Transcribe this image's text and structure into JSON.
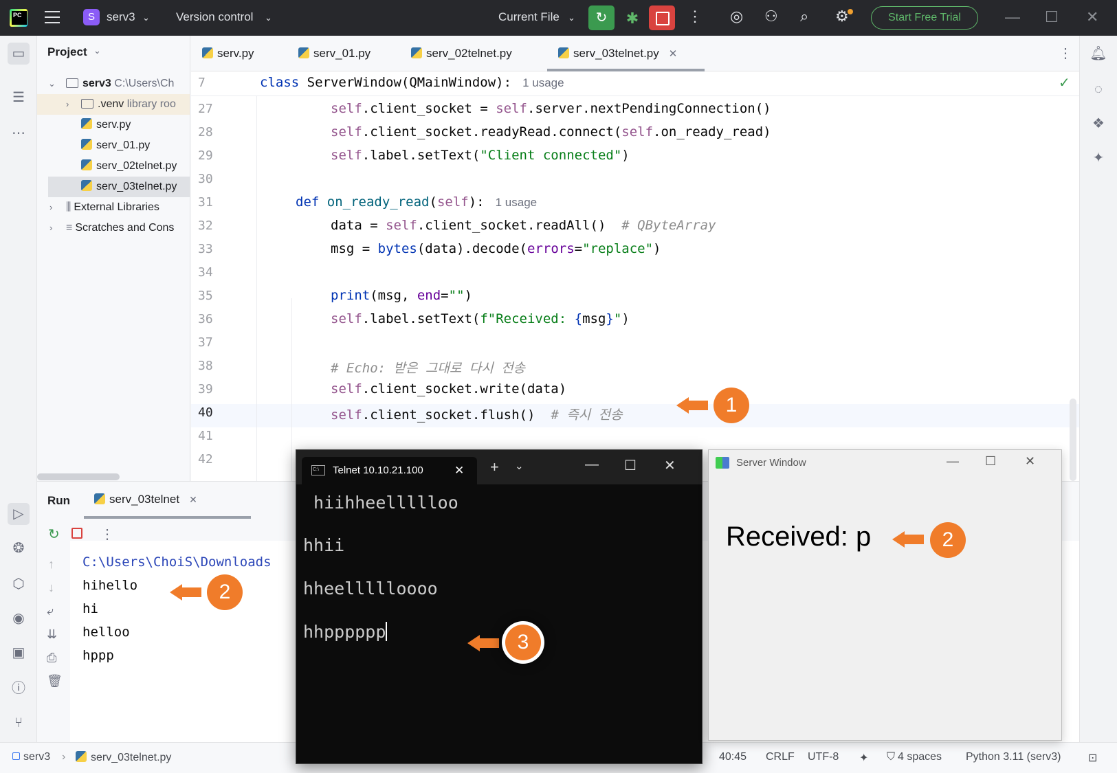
{
  "titlebar": {
    "project_badge": "S",
    "project_name": "serv3",
    "vcs": "Version control",
    "run_config": "Current File",
    "trial_button": "Start Free Trial"
  },
  "project_panel": {
    "title": "Project",
    "root_name": "serv3",
    "root_path": "C:\\Users\\Ch",
    "items": [
      {
        "label": ".venv",
        "hint": "library roo"
      },
      {
        "label": "serv.py"
      },
      {
        "label": "serv_01.py"
      },
      {
        "label": "serv_02telnet.py"
      },
      {
        "label": "serv_03telnet.py"
      },
      {
        "label": "External Libraries"
      },
      {
        "label": "Scratches and Cons"
      }
    ]
  },
  "tabs": [
    {
      "label": "serv.py"
    },
    {
      "label": "serv_01.py"
    },
    {
      "label": "serv_02telnet.py"
    },
    {
      "label": "serv_03telnet.py",
      "active": true
    }
  ],
  "editor": {
    "sticky_line": "7",
    "sticky_usage": "1 usage",
    "usage_31": "1 usage",
    "line_numbers": [
      "27",
      "28",
      "29",
      "30",
      "31",
      "32",
      "33",
      "34",
      "35",
      "36",
      "37",
      "38",
      "39",
      "40",
      "41",
      "42"
    ],
    "comment_qbyte": "# QByteArray",
    "comment_echo": "# Echo: 받은 그대로 다시 전송",
    "comment_flush": "# 즉시 전송"
  },
  "run_panel": {
    "title": "Run",
    "tab": "serv_03telnet",
    "console_lines": [
      "C:\\Users\\ChoiS\\Downloads",
      "hihello",
      "hi",
      "helloo",
      "hppp"
    ]
  },
  "telnet": {
    "title": "Telnet 10.10.21.100",
    "lines": [
      " hiihheellllloo",
      "hhii",
      "hheellllloooo",
      "hhpppppp"
    ]
  },
  "server_window": {
    "title": "Server Window",
    "label": "Received: p"
  },
  "status_bar": {
    "project": "serv3",
    "file": "serv_03telnet.py",
    "position": "40:45",
    "line_sep": "CRLF",
    "encoding": "UTF-8",
    "indent": "4 spaces",
    "interpreter": "Python 3.11 (serv3)"
  },
  "annotations": [
    "1",
    "2",
    "2",
    "3"
  ],
  "colors": {
    "accent_orange": "#f07c2a",
    "run_green": "#3b9a4f",
    "stop_red": "#d9433f",
    "trial_green": "#5fb86a"
  }
}
